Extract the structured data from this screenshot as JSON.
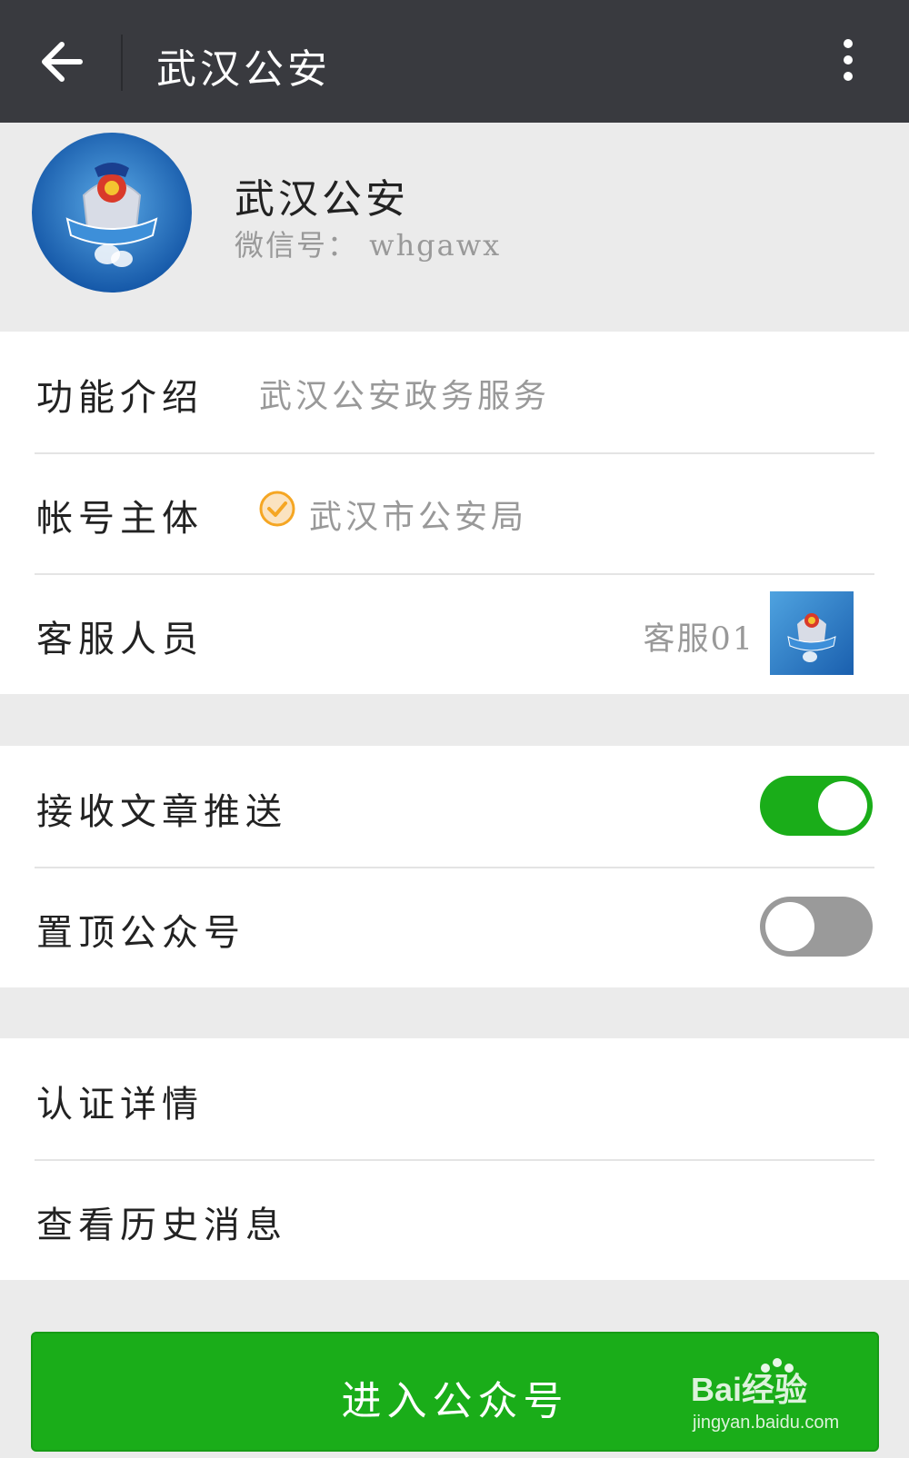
{
  "header": {
    "title": "武汉公安"
  },
  "profile": {
    "name": "武汉公安",
    "wechat_id": "微信号： whgawx"
  },
  "info": {
    "intro_label": "功能介绍",
    "intro_value": "武汉公安政务服务",
    "entity_label": "帐号主体",
    "entity_value": "武汉市公安局",
    "service_label": "客服人员",
    "service_value": "客服01"
  },
  "settings": {
    "push_label": "接收文章推送",
    "push_enabled": true,
    "pin_label": "置顶公众号",
    "pin_enabled": false
  },
  "links": {
    "cert_label": "认证详情",
    "history_label": "查看历史消息"
  },
  "action": {
    "enter_label": "进入公众号"
  },
  "watermark": {
    "brand": "Bai经验",
    "url": "jingyan.baidu.com"
  },
  "avatar_text": "武汉公安",
  "colors": {
    "topbar": "#393a3f",
    "accent_green": "#1aad19",
    "verified_orange": "#f5a623",
    "background": "#ebebeb"
  },
  "icons": [
    "back-arrow-icon",
    "more-vertical-icon",
    "verified-check-icon",
    "police-badge-icon"
  ]
}
